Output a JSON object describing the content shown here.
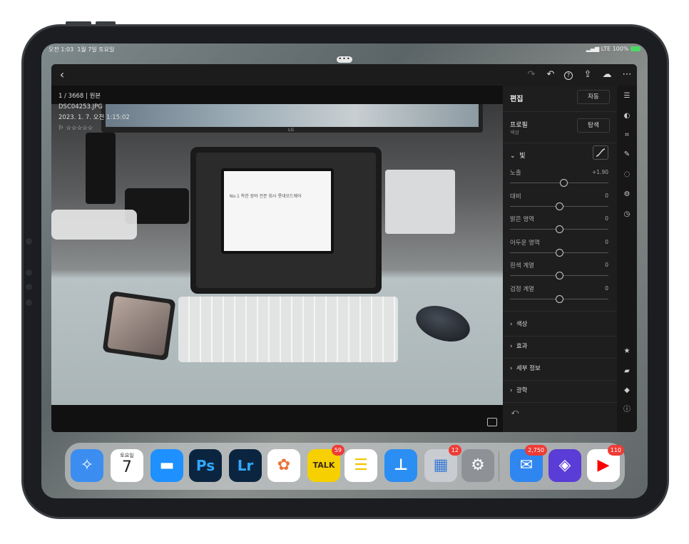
{
  "status": {
    "time": "오전 1:03",
    "date": "1월 7일 토요일",
    "network": "LTE",
    "battery": "100%"
  },
  "photo": {
    "counter": "1 / 3668 | 원본",
    "filename": "DSC04253.JPG",
    "datetime": "2023. 1. 7. 오전 1:15:02",
    "rating": "☆☆☆☆☆",
    "screen_text": "No.1 착한 장바 전문 회사 롯데모드웨어",
    "monitor_brand": "LG"
  },
  "panel": {
    "title": "편집",
    "auto_label": "자동",
    "profile_label": "프로필",
    "profile_value": "색상",
    "browse_label": "탐색",
    "light_label": "빛",
    "sliders": [
      {
        "label": "노출",
        "value": "+1.90",
        "level": 0.55
      },
      {
        "label": "대비",
        "value": "0",
        "level": 0.5
      },
      {
        "label": "밝은 영역",
        "value": "0",
        "level": 0.5
      },
      {
        "label": "어두운 영역",
        "value": "0",
        "level": 0.5
      },
      {
        "label": "흰색 계열",
        "value": "0",
        "level": 0.5
      },
      {
        "label": "검정 계열",
        "value": "0",
        "level": 0.5
      }
    ],
    "sections": [
      "색상",
      "효과",
      "세부 정보",
      "광학"
    ]
  },
  "dock": {
    "calendar": {
      "weekday": "토요일",
      "day": "7"
    },
    "apps": [
      {
        "name": "safari",
        "label": "",
        "color": "#3b8ef0"
      },
      {
        "name": "calendar",
        "label": "",
        "color": "#ffffff"
      },
      {
        "name": "files",
        "label": "",
        "color": "#1e90ff"
      },
      {
        "name": "photoshop",
        "label": "Ps",
        "color": "#0b2540"
      },
      {
        "name": "lightroom",
        "label": "Lr",
        "color": "#0b2540"
      },
      {
        "name": "photos",
        "label": "",
        "color": "#ffffff"
      },
      {
        "name": "kakaotalk",
        "label": "TALK",
        "color": "#f6d000",
        "badge": "59"
      },
      {
        "name": "notes",
        "label": "",
        "color": "#ffffff"
      },
      {
        "name": "keynote",
        "label": "",
        "color": "#2b8ef2"
      },
      {
        "name": "folder",
        "label": "",
        "color": "#c9ccd0",
        "badge": "12"
      },
      {
        "name": "settings",
        "label": "",
        "color": "#8e9296"
      },
      {
        "name": "mail",
        "label": "",
        "color": "#2f86f0",
        "badge": "2,750"
      },
      {
        "name": "shortcuts",
        "label": "",
        "color": "#5a3cd6"
      },
      {
        "name": "youtube",
        "label": "",
        "color": "#ffffff",
        "badge": "110"
      }
    ]
  }
}
